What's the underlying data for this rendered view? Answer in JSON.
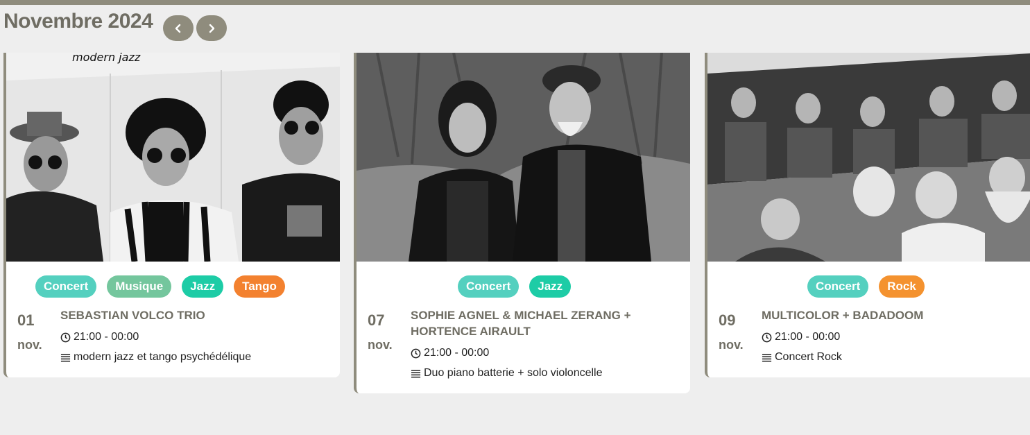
{
  "header": {
    "month": "Novembre 2024",
    "prev_icon": "chevron-left-icon",
    "next_icon": "chevron-right-icon"
  },
  "colors": {
    "accent": "#8f8c7d",
    "concert": "#54d0bf",
    "musique": "#74c69d",
    "jazz": "#1dcca6",
    "tango": "#f3812f",
    "rock": "#f4922f"
  },
  "events": [
    {
      "day": "01",
      "month": "nov.",
      "title": "SEBASTIAN VOLCO TRIO",
      "time": "21:00 - 00:00",
      "description": "modern jazz et tango psychédélique",
      "tags": [
        "Concert",
        "Musique",
        "Jazz",
        "Tango"
      ],
      "photo_text": "modern jazz"
    },
    {
      "day": "07",
      "month": "nov.",
      "title": "SOPHIE AGNEL & MICHAEL ZERANG + HORTENCE AIRAULT",
      "time": "21:00 - 00:00",
      "description": "Duo piano batterie + solo violoncelle",
      "tags": [
        "Concert",
        "Jazz"
      ]
    },
    {
      "day": "09",
      "month": "nov.",
      "title": "MULTICOLOR + BADADOOM",
      "time": "21:00 - 00:00",
      "description": "Concert Rock",
      "tags": [
        "Concert",
        "Rock"
      ]
    }
  ]
}
